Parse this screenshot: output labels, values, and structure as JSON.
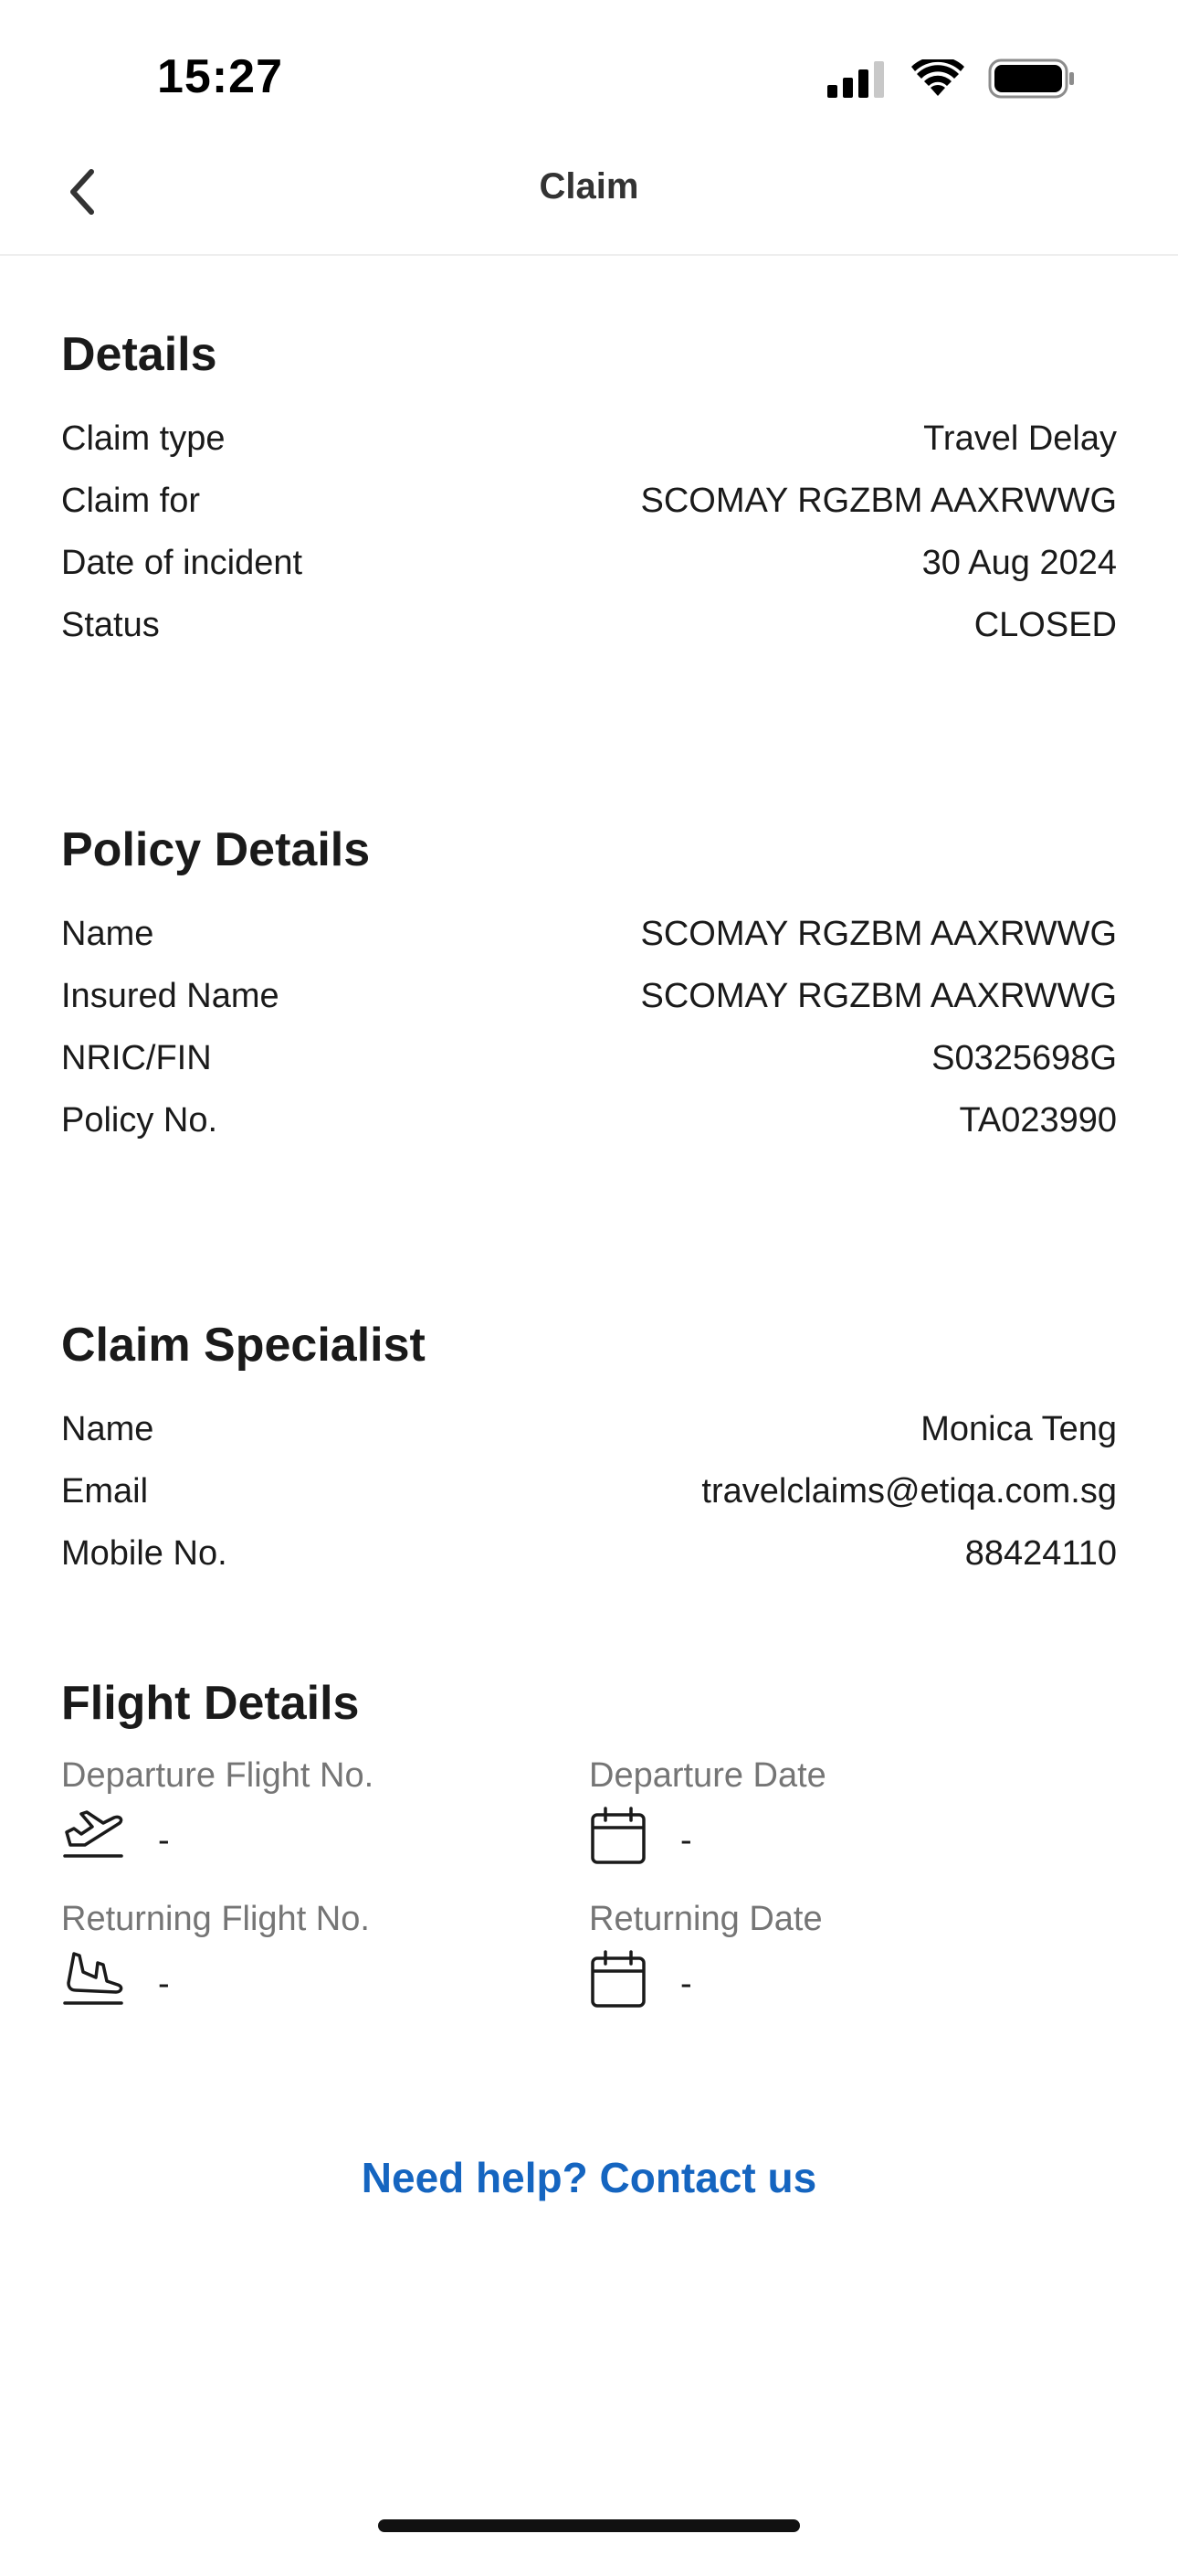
{
  "status_bar": {
    "time": "15:27"
  },
  "nav": {
    "title": "Claim"
  },
  "details": {
    "title": "Details",
    "rows": [
      {
        "label": "Claim type",
        "value": "Travel Delay"
      },
      {
        "label": "Claim for",
        "value": "SCOMAY RGZBM AAXRWWG"
      },
      {
        "label": "Date of incident",
        "value": "30 Aug 2024"
      },
      {
        "label": "Status",
        "value": "CLOSED"
      }
    ]
  },
  "policy": {
    "title": "Policy Details",
    "rows": [
      {
        "label": "Name",
        "value": "SCOMAY RGZBM AAXRWWG"
      },
      {
        "label": "Insured Name",
        "value": "SCOMAY RGZBM AAXRWWG"
      },
      {
        "label": "NRIC/FIN",
        "value": "S0325698G"
      },
      {
        "label": "Policy No.",
        "value": "TA023990"
      }
    ]
  },
  "specialist": {
    "title": "Claim Specialist",
    "rows": [
      {
        "label": "Name",
        "value": "Monica Teng"
      },
      {
        "label": "Email",
        "value": "travelclaims@etiqa.com.sg"
      },
      {
        "label": "Mobile No.",
        "value": "88424110"
      }
    ]
  },
  "flight": {
    "title": "Flight Details",
    "departure_flight": {
      "label": "Departure Flight No.",
      "value": "-",
      "icon": "plane-takeoff-icon"
    },
    "departure_date": {
      "label": "Departure Date",
      "value": "-",
      "icon": "calendar-icon"
    },
    "returning_flight": {
      "label": "Returning Flight No.",
      "value": "-",
      "icon": "plane-landing-icon"
    },
    "returning_date": {
      "label": "Returning Date",
      "value": "-",
      "icon": "calendar-icon"
    }
  },
  "help": {
    "label": "Need help? Contact us"
  },
  "colors": {
    "link": "#1565c0",
    "muted_label": "#757575",
    "text": "#1a1a1a"
  }
}
